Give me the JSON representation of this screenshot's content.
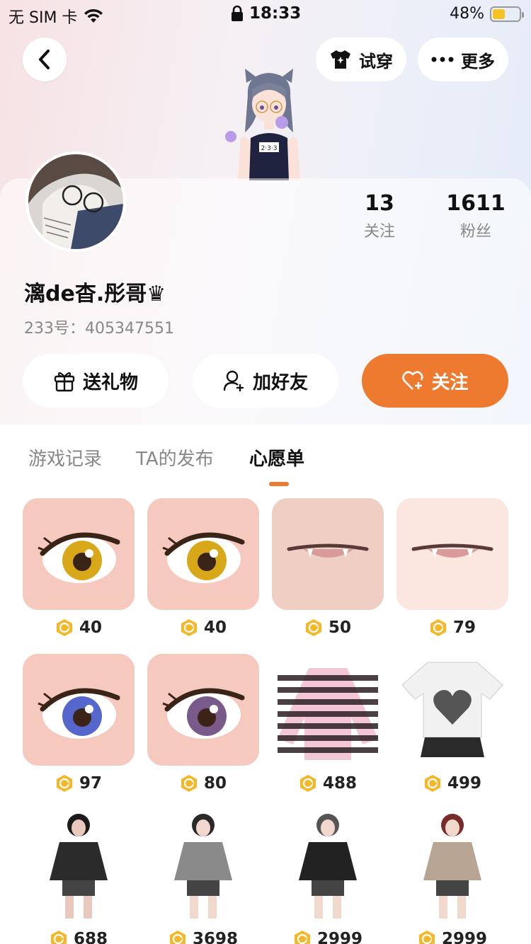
{
  "status_bar": {
    "carrier": "无 SIM 卡",
    "time": "18:33",
    "battery": "48%",
    "battery_level": 0.48
  },
  "header": {
    "back_icon": "chevron-left-icon",
    "tryon_label": "试穿",
    "more_label": "更多"
  },
  "profile": {
    "username": "漓de杳.彤哥♛",
    "uid": "233号：405347551",
    "stats": {
      "following_count": "13",
      "following_label": "关注",
      "fans_count": "1611",
      "fans_label": "粉丝"
    }
  },
  "actions": {
    "gift_label": "送礼物",
    "add_friend_label": "加好友",
    "follow_label": "关注"
  },
  "tabs": [
    {
      "label": "游戏记录",
      "active": false
    },
    {
      "label": "TA的发布",
      "active": false
    },
    {
      "label": "心愿单",
      "active": true
    }
  ],
  "wishlist": [
    {
      "kind": "eye",
      "price": "40"
    },
    {
      "kind": "eye",
      "price": "40"
    },
    {
      "kind": "mouth",
      "price": "50"
    },
    {
      "kind": "mouth",
      "price": "79"
    },
    {
      "kind": "eye",
      "price": "97"
    },
    {
      "kind": "eye",
      "price": "80"
    },
    {
      "kind": "sweater",
      "price": "488"
    },
    {
      "kind": "outfit",
      "price": "499"
    },
    {
      "kind": "outfit",
      "price": "688"
    },
    {
      "kind": "outfit",
      "price": "3698"
    },
    {
      "kind": "outfit",
      "price": "2999"
    },
    {
      "kind": "outfit",
      "price": "2999"
    }
  ],
  "colors": {
    "accent": "#ee7a2f",
    "coin": "#f2b82a"
  }
}
